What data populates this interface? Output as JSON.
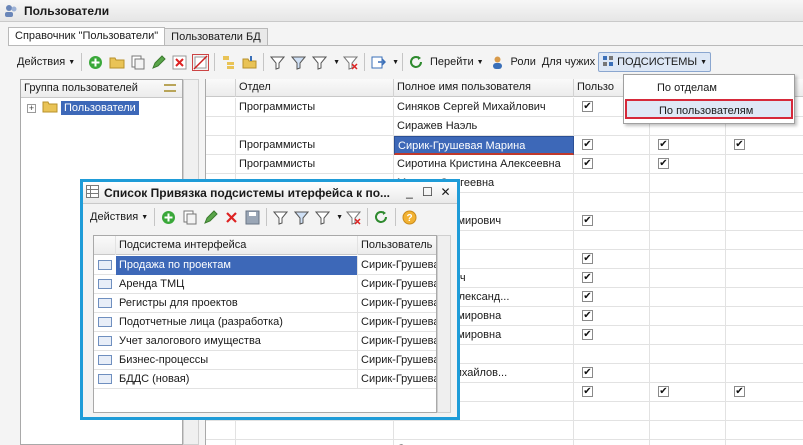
{
  "window": {
    "title": "Пользователи"
  },
  "tabs": [
    {
      "label": "Справочник \"Пользователи\"",
      "active": true
    },
    {
      "label": "Пользователи БД",
      "active": false
    }
  ],
  "toolbar": {
    "actions_label": "Действия",
    "goto_label": "Перейти",
    "roles_label": "Роли",
    "foreign_label": "Для чужих",
    "subsystems_label": "ПОДСИСТЕМЫ"
  },
  "menu": {
    "items": [
      {
        "label": "По отделам",
        "highlighted": false
      },
      {
        "label": "По пользователям",
        "highlighted": true
      }
    ]
  },
  "left_panel": {
    "header": "Группа пользователей",
    "tree_root": "Пользователи"
  },
  "grid": {
    "headers": [
      "Отдел",
      "Полное имя пользователя",
      "Пользо"
    ],
    "rows": [
      {
        "dept": "Программисты",
        "name": "Синяков Сергей Михайлович",
        "checks": [
          true,
          false,
          false
        ]
      },
      {
        "dept": "",
        "name": "Сиражев Наэль",
        "checks": [
          false,
          false,
          false
        ]
      },
      {
        "dept": "Программисты",
        "name": "Сирик-Грушевая Марина",
        "checks": [
          true,
          true,
          true
        ]
      },
      {
        "dept": "Программисты",
        "name": "Сиротина Кристина Алексеевна",
        "checks": [
          true,
          true,
          false
        ]
      },
      {
        "dept": "",
        "name": "Марина Сергеевна",
        "checks": [
          false,
          false,
          false
        ]
      },
      {
        "dept": "",
        "name": "О.В.",
        "checks": [
          false,
          false,
          false
        ]
      },
      {
        "dept": "",
        "name": "Олег Владимирович",
        "checks": [
          true,
          false,
          false
        ]
      },
      {
        "dept": "",
        "name": "Олег",
        "checks": [
          false,
          false,
          false
        ]
      },
      {
        "dept": "",
        "name": "аталья",
        "checks": [
          true,
          false,
          false
        ]
      },
      {
        "dept": "",
        "name": "ья Сергеевич",
        "checks": [
          true,
          false,
          false
        ]
      },
      {
        "dept": "",
        "name": "ов Сергей Александ...",
        "checks": [
          true,
          false,
          false
        ]
      },
      {
        "dept": "",
        "name": "лена Владимировна",
        "checks": [
          true,
          false,
          false
        ]
      },
      {
        "dept": "",
        "name": "лена Владимировна",
        "checks": [
          true,
          false,
          false
        ]
      },
      {
        "dept": "",
        "name": "",
        "checks": [
          false,
          false,
          false
        ]
      },
      {
        "dept": "",
        "name": "а Оксана Михайлов...",
        "checks": [
          true,
          false,
          false
        ]
      },
      {
        "dept": "",
        "name": "а Лилия",
        "checks": [
          true,
          true,
          true
        ]
      },
      {
        "dept": "",
        "name": "",
        "checks": [
          false,
          false,
          false
        ]
      },
      {
        "dept": "",
        "name": "",
        "checks": [
          false,
          false,
          false
        ]
      },
      {
        "dept": "",
        "name": "Смирнов",
        "checks": [
          false,
          false,
          false
        ]
      }
    ]
  },
  "dialog": {
    "title": "Список Привязка подсистемы итерфейса к по...",
    "actions_label": "Действия",
    "headers": [
      "Подсистема интерфейса",
      "Пользователь"
    ],
    "rows": [
      {
        "subsystem": "Продажа по проектам",
        "user": "Сирик-Грушевая",
        "selected": true
      },
      {
        "subsystem": "Аренда ТМЦ",
        "user": "Сирик-Грушевая",
        "selected": false
      },
      {
        "subsystem": "Регистры для проектов",
        "user": "Сирик-Грушевая",
        "selected": false
      },
      {
        "subsystem": "Подотчетные лица (разработка)",
        "user": "Сирик-Грушевая",
        "selected": false
      },
      {
        "subsystem": "Учет залогового имущества",
        "user": "Сирик-Грушевая",
        "selected": false
      },
      {
        "subsystem": "Бизнес-процессы",
        "user": "Сирик-Грушевая",
        "selected": false
      },
      {
        "subsystem": "БДДС (новая)",
        "user": "Сирик-Грушевая",
        "selected": false
      }
    ]
  },
  "colors": {
    "selection": "#3d68b8",
    "dialog_border": "#1f9cd8",
    "highlight_border": "#d6293a"
  }
}
